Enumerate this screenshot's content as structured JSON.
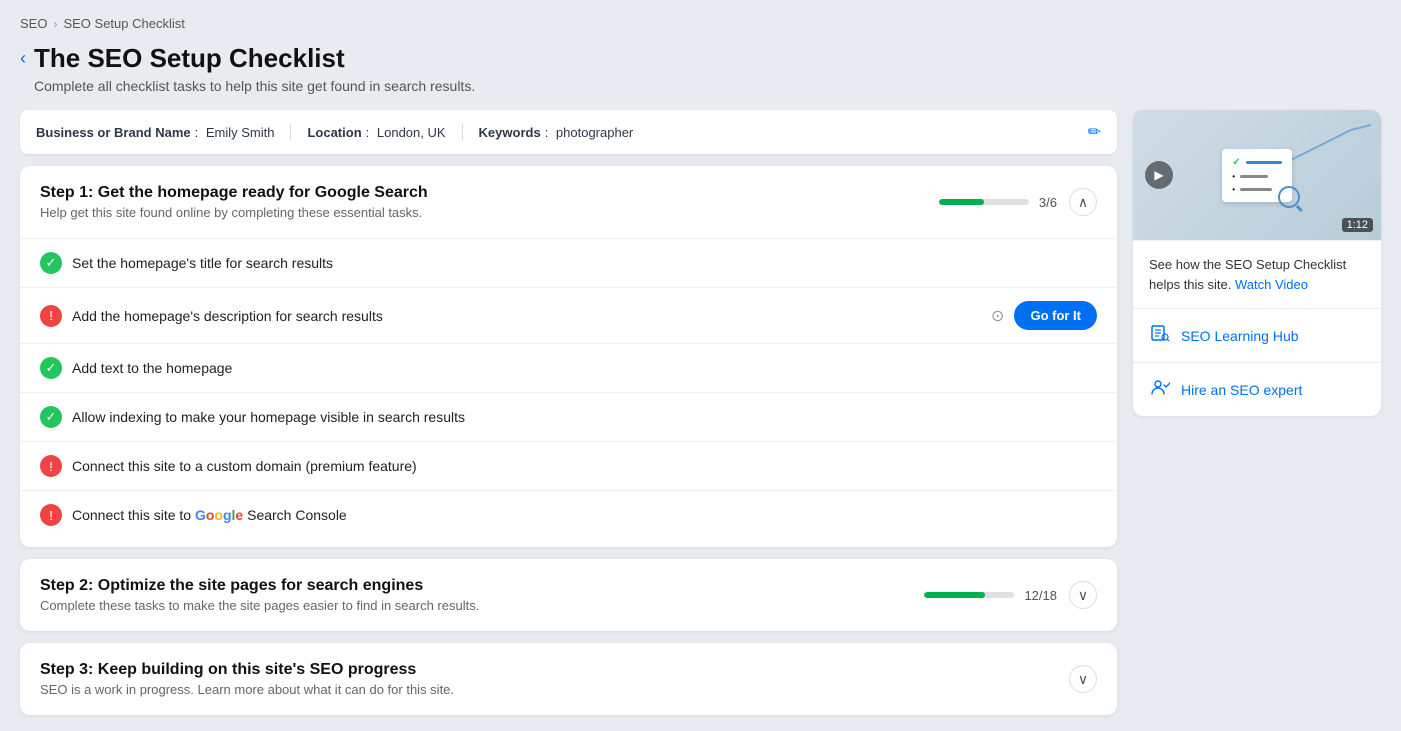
{
  "breadcrumb": {
    "parent": "SEO",
    "current": "SEO Setup Checklist",
    "separator": "›"
  },
  "page": {
    "back_icon": "‹",
    "title": "The SEO Setup Checklist",
    "subtitle": "Complete all checklist tasks to help this site get found in search results."
  },
  "info_bar": {
    "business_label": "Business or Brand Name",
    "business_value": "Emily Smith",
    "location_label": "Location",
    "location_value": "London, UK",
    "keywords_label": "Keywords",
    "keywords_value": "photographer",
    "edit_icon": "✏"
  },
  "steps": [
    {
      "id": "step1",
      "title": "Step 1: Get the homepage ready for Google Search",
      "subtitle": "Help get this site found online by completing these essential tasks.",
      "progress_current": 3,
      "progress_total": 6,
      "progress_pct": 50,
      "expanded": true,
      "toggle_icon": "∧",
      "tasks": [
        {
          "id": "t1",
          "status": "success",
          "label": "Set the homepage's title for search results",
          "has_button": false
        },
        {
          "id": "t2",
          "status": "error",
          "label": "Add the homepage's description for search results",
          "has_button": true,
          "button_label": "Go for It"
        },
        {
          "id": "t3",
          "status": "success",
          "label": "Add text to the homepage",
          "has_button": false
        },
        {
          "id": "t4",
          "status": "success",
          "label": "Allow indexing to make your homepage visible in search results",
          "has_button": false
        },
        {
          "id": "t5",
          "status": "error",
          "label": "Connect this site to a custom domain (premium feature)",
          "has_button": false
        },
        {
          "id": "t6",
          "status": "error",
          "label": "Connect this site to Google Search Console",
          "has_button": false,
          "has_google": true
        }
      ]
    },
    {
      "id": "step2",
      "title": "Step 2: Optimize the site pages for search engines",
      "subtitle": "Complete these tasks to make the site pages easier to find in search results.",
      "progress_current": 12,
      "progress_total": 18,
      "progress_pct": 67,
      "expanded": false,
      "toggle_icon": "∨"
    },
    {
      "id": "step3",
      "title": "Step 3: Keep building on this site's SEO progress",
      "subtitle": "SEO is a work in progress. Learn more about what it can do for this site.",
      "progress_current": null,
      "progress_total": null,
      "progress_pct": 0,
      "expanded": false,
      "toggle_icon": "∨"
    }
  ],
  "sidebar": {
    "video": {
      "duration": "1:12",
      "play_icon": "▶"
    },
    "video_text": "See how the SEO Setup Checklist helps this site.",
    "video_link": "Watch Video",
    "learning_hub": {
      "icon": "📋",
      "label": "SEO Learning Hub"
    },
    "hire_expert": {
      "icon": "🤝",
      "label": "Hire an SEO expert"
    }
  }
}
